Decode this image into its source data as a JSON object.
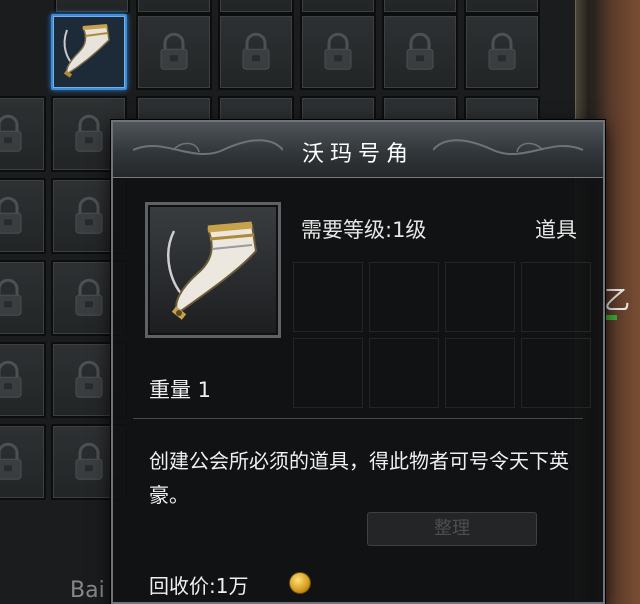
{
  "tooltip": {
    "title": "沃玛号角",
    "level_requirement": "需要等级:1级",
    "item_type": "道具",
    "weight": "重量 1",
    "description": "创建公会所必须的道具，得此物者可号令天下英豪。",
    "faded_button": "整理",
    "price": "回收价:1万",
    "coin_icon": "gold-coin-icon"
  },
  "side": {
    "partial_text": "乙"
  },
  "watermark": {
    "text": "Bai"
  },
  "colors": {
    "selected_slot_border": "#3f8cd6",
    "tooltip_border": "#6f747a",
    "text": "#f0f0f0"
  },
  "icons": {
    "lock": "padlock-icon",
    "item": "war-horn-icon"
  }
}
